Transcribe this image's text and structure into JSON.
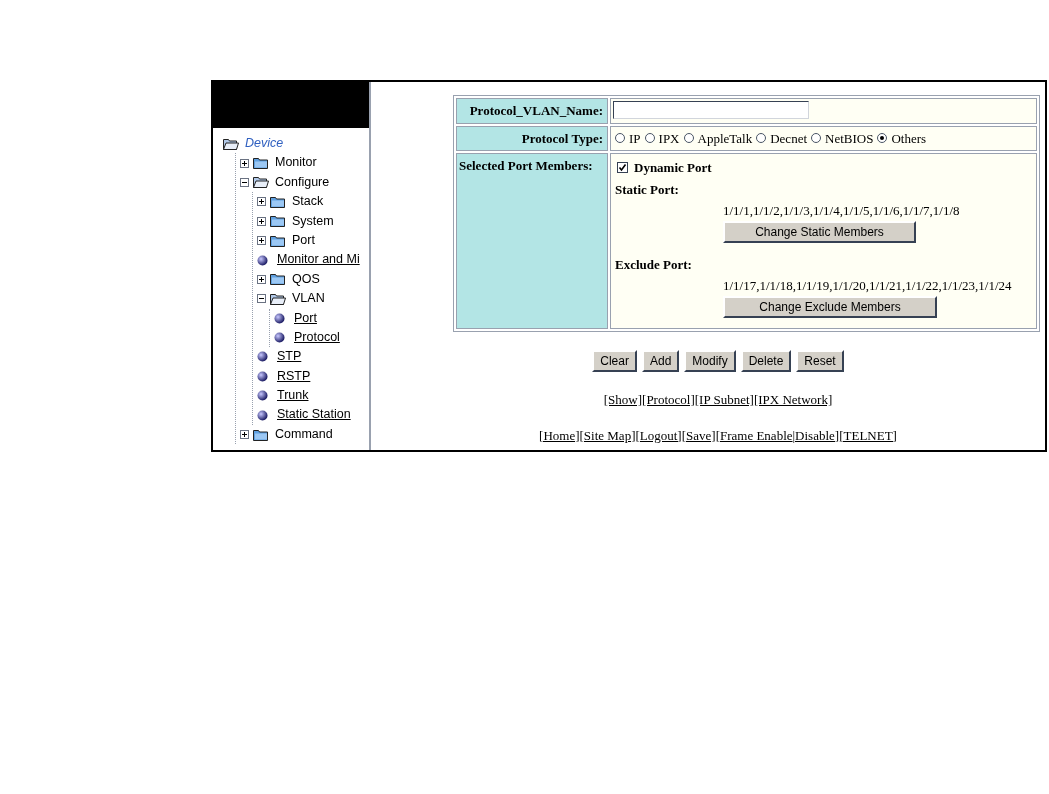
{
  "tree": {
    "label": "Device",
    "kind": "root",
    "children": [
      {
        "label": "Monitor",
        "kind": "folder",
        "expanded": false
      },
      {
        "label": "Configure",
        "kind": "folder",
        "expanded": true,
        "children": [
          {
            "label": "Stack",
            "kind": "folder",
            "expanded": false
          },
          {
            "label": "System",
            "kind": "folder",
            "expanded": false
          },
          {
            "label": "Port",
            "kind": "folder",
            "expanded": false
          },
          {
            "label": "Monitor and Mi",
            "kind": "link"
          },
          {
            "label": "QOS",
            "kind": "folder",
            "expanded": false
          },
          {
            "label": "VLAN",
            "kind": "folder",
            "expanded": true,
            "children": [
              {
                "label": "Port",
                "kind": "link"
              },
              {
                "label": "Protocol",
                "kind": "link"
              }
            ]
          },
          {
            "label": "STP",
            "kind": "link"
          },
          {
            "label": "RSTP",
            "kind": "link"
          },
          {
            "label": "Trunk",
            "kind": "link"
          },
          {
            "label": "Static Station",
            "kind": "link"
          }
        ]
      },
      {
        "label": "Command",
        "kind": "folder",
        "expanded": false
      }
    ]
  },
  "form": {
    "name_label": "Protocol_VLAN_Name:",
    "type_label": "Protocol Type:",
    "protocol_types": [
      {
        "label": "IP",
        "selected": false
      },
      {
        "label": "IPX",
        "selected": false
      },
      {
        "label": "AppleTalk",
        "selected": false
      },
      {
        "label": "Decnet",
        "selected": false
      },
      {
        "label": "NetBIOS",
        "selected": false
      },
      {
        "label": "Others",
        "selected": true
      }
    ],
    "members_label": "Selected Port Members:",
    "dynamic_port": {
      "label": "Dynamic Port",
      "checked": true
    },
    "static_label": "Static Port:",
    "static_ports": "1/1/1,1/1/2,1/1/3,1/1/4,1/1/5,1/1/6,1/1/7,1/1/8",
    "static_button": "Change Static Members",
    "exclude_label": "Exclude Port:",
    "exclude_ports": "1/1/17,1/1/18,1/1/19,1/1/20,1/1/21,1/1/22,1/1/23,1/1/24",
    "exclude_button": "Change Exclude Members"
  },
  "buttons": [
    "Clear",
    "Add",
    "Modify",
    "Delete",
    "Reset"
  ],
  "vlan_links": [
    "[Show]",
    "[Protocol]",
    "[IP Subnet]",
    "[IPX Network]"
  ],
  "footer_links": [
    "[Home]",
    "[Site Map]",
    "[Logout]",
    "[Save]",
    "[Frame Enable",
    "|Disable]",
    "[TELNET]"
  ]
}
